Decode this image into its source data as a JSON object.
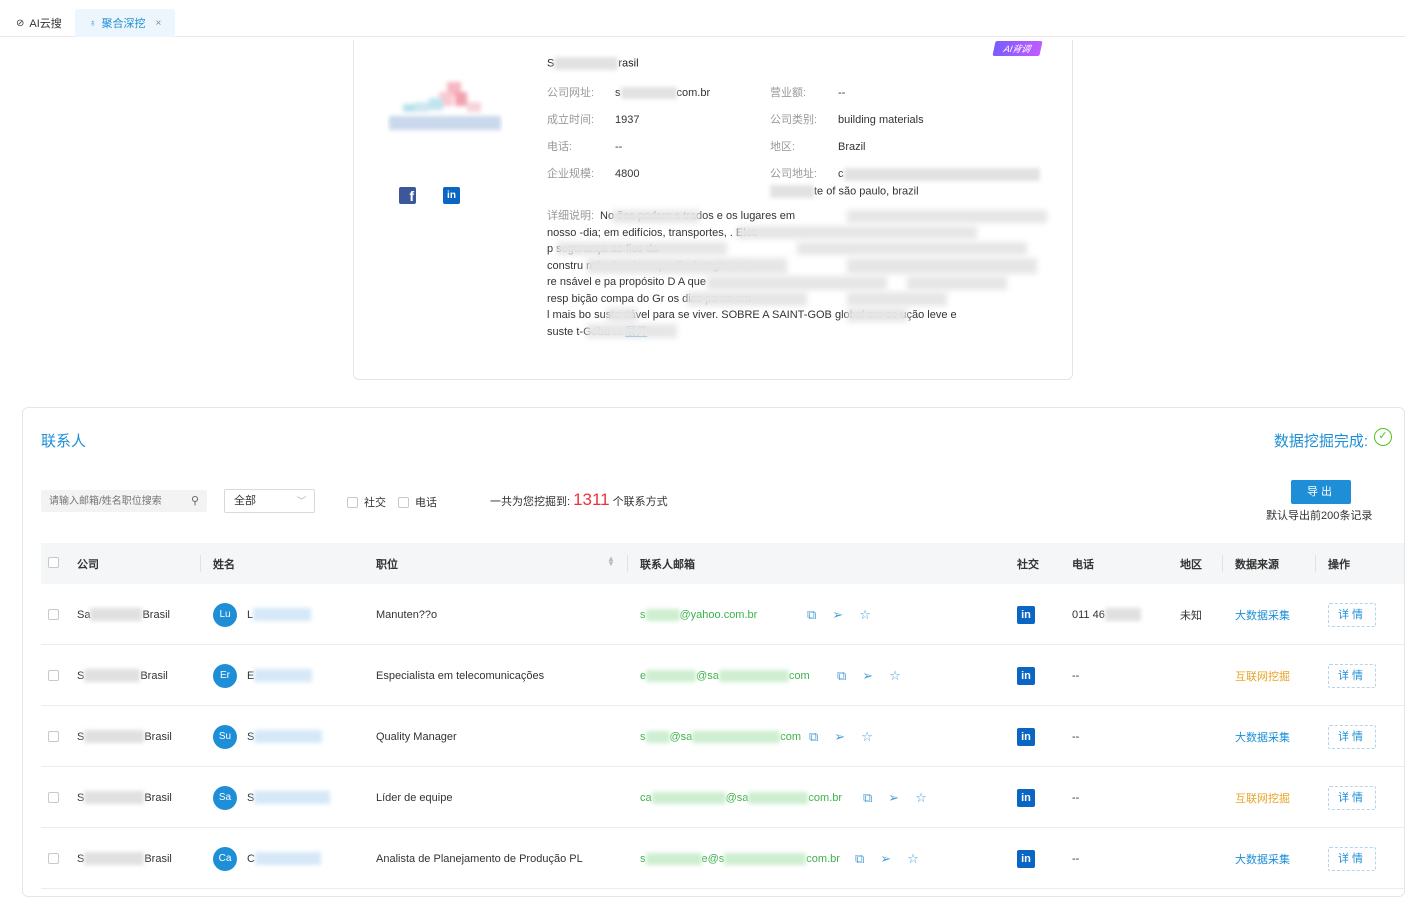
{
  "tabs": [
    {
      "label": "AI云搜",
      "icon": "ai-icon"
    },
    {
      "label": "聚合深挖",
      "icon": "bell-icon",
      "close": "×"
    }
  ],
  "company": {
    "ai_badge": "AI背调",
    "name_prefix": "S",
    "name_suffix": "rasil",
    "fields": {
      "website_label": "公司网址:",
      "website_prefix": "s",
      "website_suffix": "com.br",
      "revenue_label": "营业额:",
      "revenue": "--",
      "founded_label": "成立时间:",
      "founded": "1937",
      "category_label": "公司类别:",
      "category": "building materials",
      "phone_label": "电话:",
      "phone": "--",
      "region_label": "地区:",
      "region": "Brazil",
      "size_label": "企业规模:",
      "size": "4800",
      "address_label": "公司地址:",
      "address_prefix": "c",
      "address_line2": "te of são paulo, brazil"
    },
    "desc_label": "详细说明:",
    "desc_lines": [
      "No                     ões podem s             trados e           os lugares em",
      "nosso      -dia; em edifícios, transportes,                                      . Eles",
      "p                         segurança ao                                              fios da",
      "constru        ntável,          ncia                          ança climát              tegia      esc",
      "re     nsável e pa          propósito                                 D A               que",
      "resp          bição compa                  do Gr               os dias pa             un       um",
      "l         mais bo        sustentável para se viver. SOBRE A SAINT-GOB            global em co       ução leve e",
      "suste              t-Goba ..."
    ],
    "expand": "展开"
  },
  "contacts": {
    "title": "联系人",
    "done_label": "数据挖掘完成:",
    "search_placeholder": "请输入邮箱/姓名职位搜索",
    "select_value": "全部",
    "filter_social": "社交",
    "filter_phone": "电话",
    "count_prefix": "一共为您挖掘到:",
    "count": "1311",
    "count_suffix": "个联系方式",
    "export_label": "导出",
    "export_note": "默认导出前200条记录",
    "columns": {
      "company": "公司",
      "name": "姓名",
      "position": "职位",
      "email": "联系人邮箱",
      "social": "社交",
      "phone": "电话",
      "region": "地区",
      "source": "数据来源",
      "action": "操作"
    },
    "rows": [
      {
        "company_prefix": "Sa",
        "company_suffix": "Brasil",
        "avatar": "Lu",
        "name_prefix": "L",
        "position": "Manuten??o",
        "email_prefix": "s",
        "email_suffix": "@yahoo.com.br",
        "email_mid": "",
        "phone": "011 46",
        "region": "未知",
        "source": "大数据采集",
        "source_type": "blue",
        "action": "详情"
      },
      {
        "company_prefix": "S",
        "company_suffix": "Brasil",
        "avatar": "Er",
        "name_prefix": "E",
        "position": "Especialista em telecomunicações",
        "email_prefix": "e",
        "email_mid": "@sa",
        "email_suffix": "com",
        "phone": "--",
        "region": "",
        "source": "互联网挖掘",
        "source_type": "orange",
        "action": "详情"
      },
      {
        "company_prefix": "S",
        "company_suffix": "Brasil",
        "avatar": "Su",
        "name_prefix": "S",
        "position": "Quality Manager",
        "email_prefix": "s",
        "email_mid": "@sa",
        "email_suffix": "com",
        "phone": "--",
        "region": "",
        "source": "大数据采集",
        "source_type": "blue",
        "action": "详情"
      },
      {
        "company_prefix": "S",
        "company_suffix": "Brasil",
        "avatar": "Sa",
        "name_prefix": "S",
        "position": "Líder de equipe",
        "email_prefix": "ca",
        "email_mid": "@sa",
        "email_suffix": "com.br",
        "phone": "--",
        "region": "",
        "source": "互联网挖掘",
        "source_type": "orange",
        "action": "详情"
      },
      {
        "company_prefix": "S",
        "company_suffix": "Brasil",
        "avatar": "Ca",
        "name_prefix": "C",
        "position": "Analista de Planejamento de Produção PL",
        "email_prefix": "s",
        "email_mid": "e@s",
        "email_suffix": "com.br",
        "phone": "--",
        "region": "",
        "source": "大数据采集",
        "source_type": "blue",
        "action": "详情"
      }
    ]
  },
  "colors": {
    "accent": "#1e8fd6",
    "count": "#e8353b",
    "email": "#3bb24a",
    "source_orange": "#e8a52a",
    "done": "#52c41a"
  }
}
